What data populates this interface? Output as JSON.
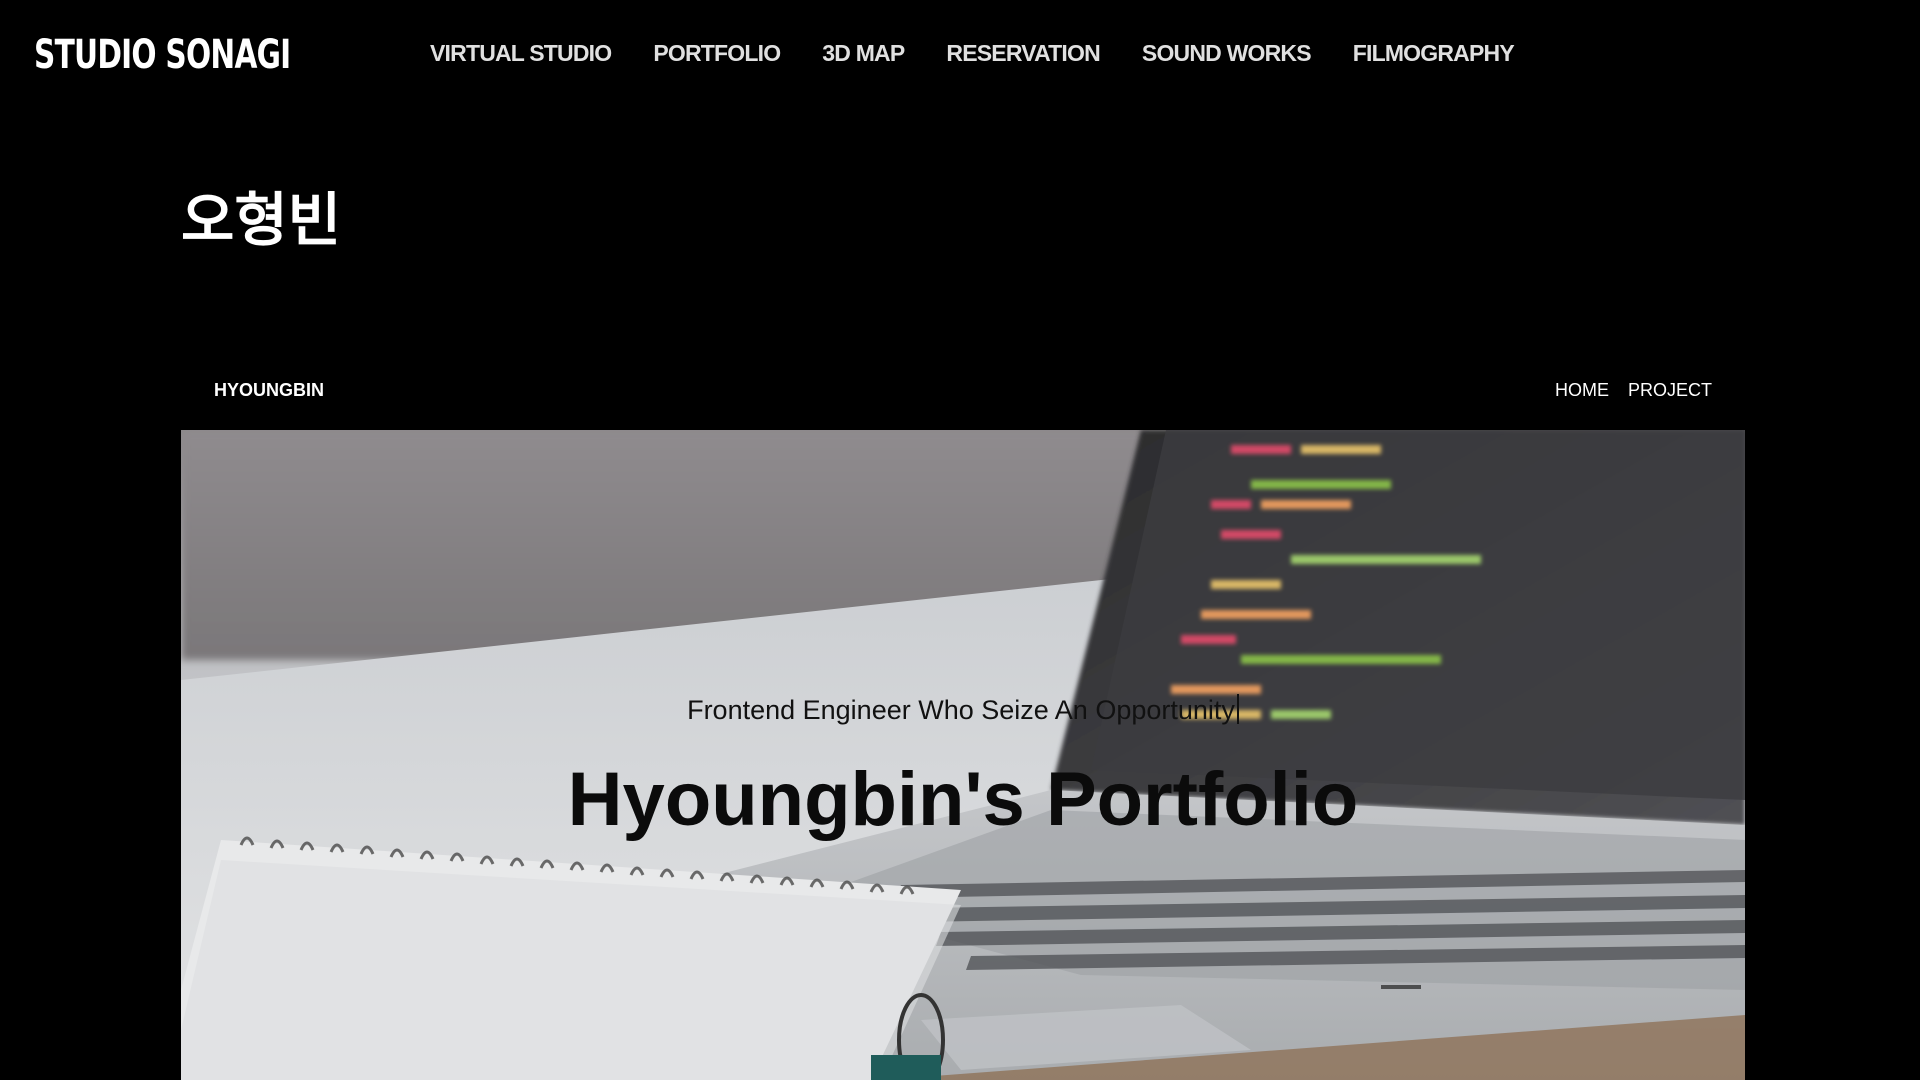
{
  "site": {
    "logo": "STUDIO SONAGI",
    "nav": [
      {
        "label": "VIRTUAL STUDIO"
      },
      {
        "label": "PORTFOLIO"
      },
      {
        "label": "3D MAP"
      },
      {
        "label": "RESERVATION"
      },
      {
        "label": "SOUND WORKS"
      },
      {
        "label": "FILMOGRAPHY"
      }
    ]
  },
  "page": {
    "heading": "오형빈"
  },
  "embed": {
    "brand": "HYOUNGBIN",
    "menu": [
      {
        "label": "HOME"
      },
      {
        "label": "PROJECT"
      }
    ],
    "hero": {
      "subtitle": "Frontend Engineer Who Seize An Opportunity",
      "title": "Hyoungbin's Portfolio"
    }
  },
  "colors": {
    "background": "#000000",
    "nav_text": "#e0e0e0",
    "heading_text": "#ffffff",
    "hero_title": "#0b0b0b"
  }
}
